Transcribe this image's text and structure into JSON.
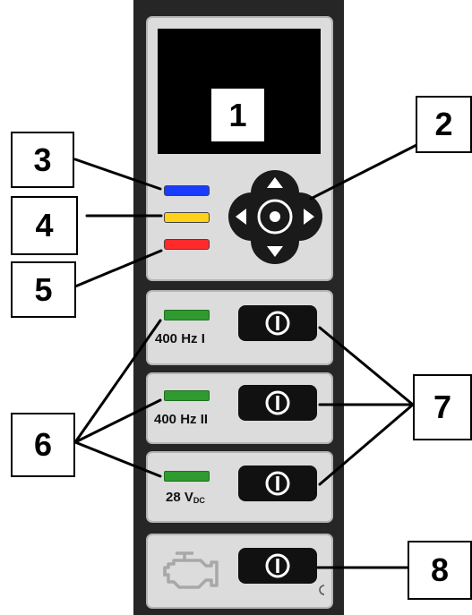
{
  "callouts": {
    "screen": "1",
    "nav_pad": "2",
    "led_blue": "3",
    "led_yellow": "4",
    "led_red": "5",
    "channel_leds": "6",
    "power_buttons": "7",
    "engine_button": "8"
  },
  "channels": [
    {
      "label_main": "400 Hz I",
      "label_sub": "",
      "led_color": "#2f9a2f"
    },
    {
      "label_main": "400 Hz II",
      "label_sub": "",
      "led_color": "#2f9a2f"
    },
    {
      "label_main": "28 V",
      "label_sub": "DC",
      "led_color": "#2f9a2f"
    }
  ],
  "status_leds": {
    "blue": "#1a3cff",
    "yellow": "#ffd21a",
    "red": "#ff2a2a"
  },
  "icons": {
    "nav": "directional-pad-icon",
    "power": "power-icon",
    "engine": "engine-icon",
    "arc": "arc-indicator-icon"
  }
}
